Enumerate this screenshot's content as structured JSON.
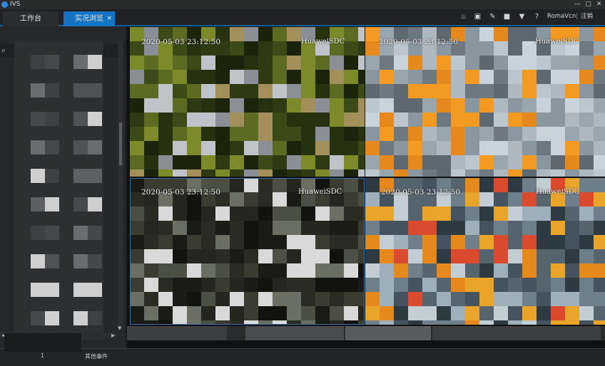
{
  "window": {
    "title": "IVS",
    "controls": [
      "—",
      "□",
      "✕"
    ]
  },
  "tabs": [
    {
      "label": "工作台",
      "active": false
    },
    {
      "label": "实况浏览",
      "active": true,
      "close": "×"
    }
  ],
  "toolbar": {
    "icons": [
      "alarm-icon",
      "screenshot-icon",
      "wrench-icon",
      "lock-icon",
      "shirt-icon",
      "help-icon"
    ],
    "user": "RomaVcn",
    "separator": "|",
    "logout": "注销"
  },
  "sidebar": {
    "search_icon": "search-icon"
  },
  "video_panes": [
    {
      "timestamp": "2020-05-03   23:12:50",
      "brand": "HuaweiSDC"
    },
    {
      "timestamp": "2020-05-03   23:12:50",
      "brand": "HuaweiSDC"
    },
    {
      "timestamp": "2020-05-03   23:12:50",
      "brand": "HuaweiSDC"
    },
    {
      "timestamp": "2020-05-03   23:12:50",
      "brand": "HuaweiSDC"
    }
  ],
  "statusbar": {
    "count": "1",
    "event_label": "其他事件"
  },
  "colors": {
    "accent": "#1474c3",
    "active_tab": "#1474c3",
    "background": "#1c1d1f",
    "orange": "#e6891c"
  }
}
